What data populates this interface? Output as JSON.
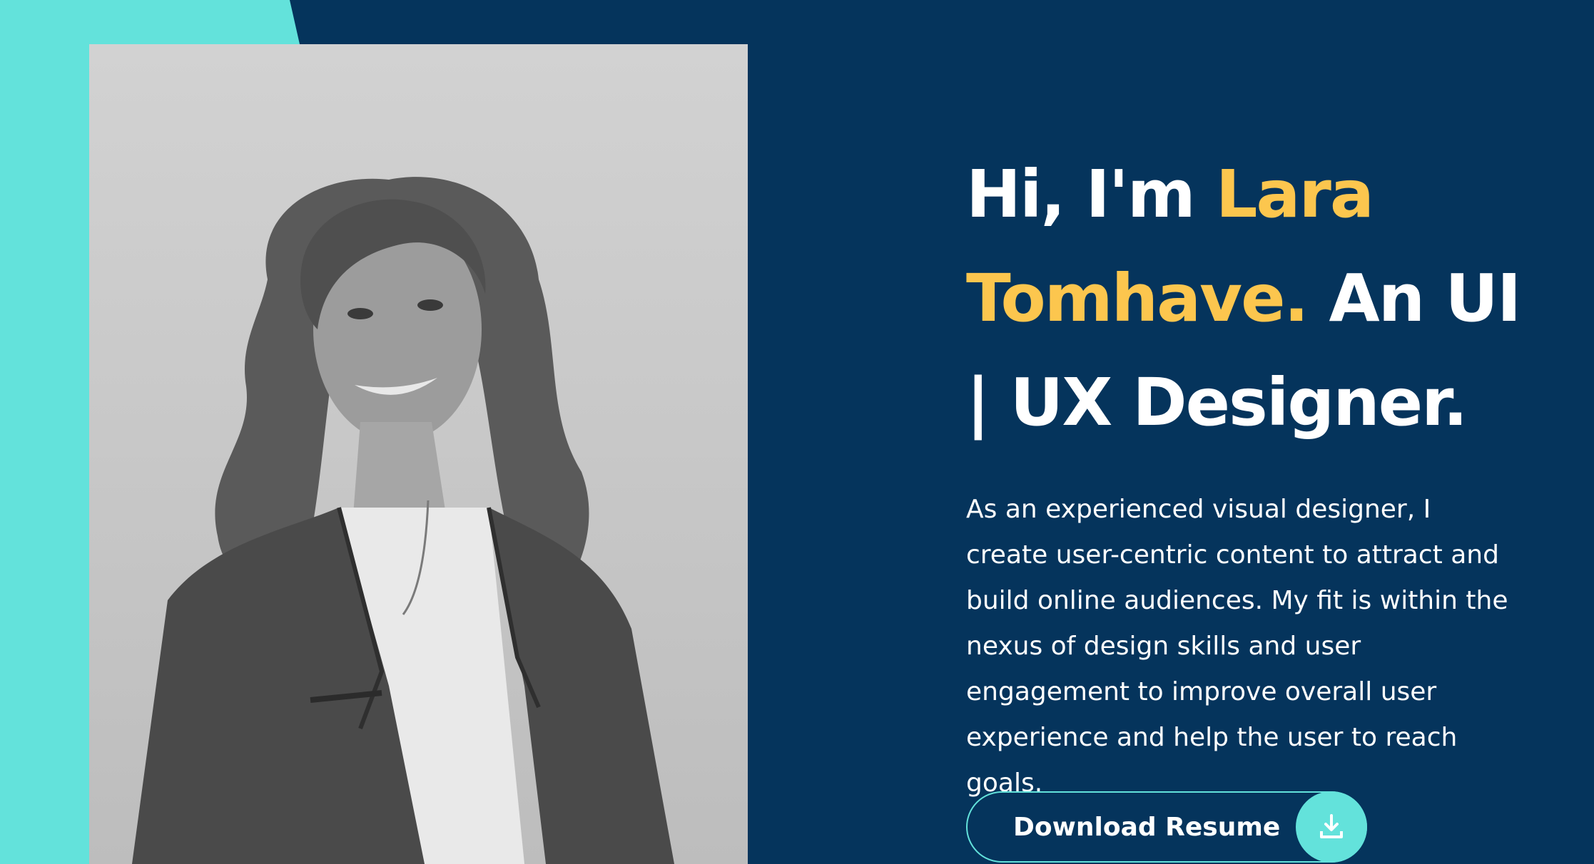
{
  "hero": {
    "greeting": "Hi, I'm ",
    "name": "Lara Tomhave.",
    "role": " An UI | UX Designer.",
    "intro": "As an experienced visual designer, I create user-centric content to attract and build online audiences. My fit is within the nexus of design skills and user engagement to improve overall user experience and help the user to reach goals."
  },
  "resume_button": {
    "label": "Download Resume",
    "icon": "download-icon"
  },
  "colors": {
    "navy": "#05345c",
    "teal": "#63e2db",
    "accent": "#fcc64e",
    "text": "#ffffff"
  }
}
